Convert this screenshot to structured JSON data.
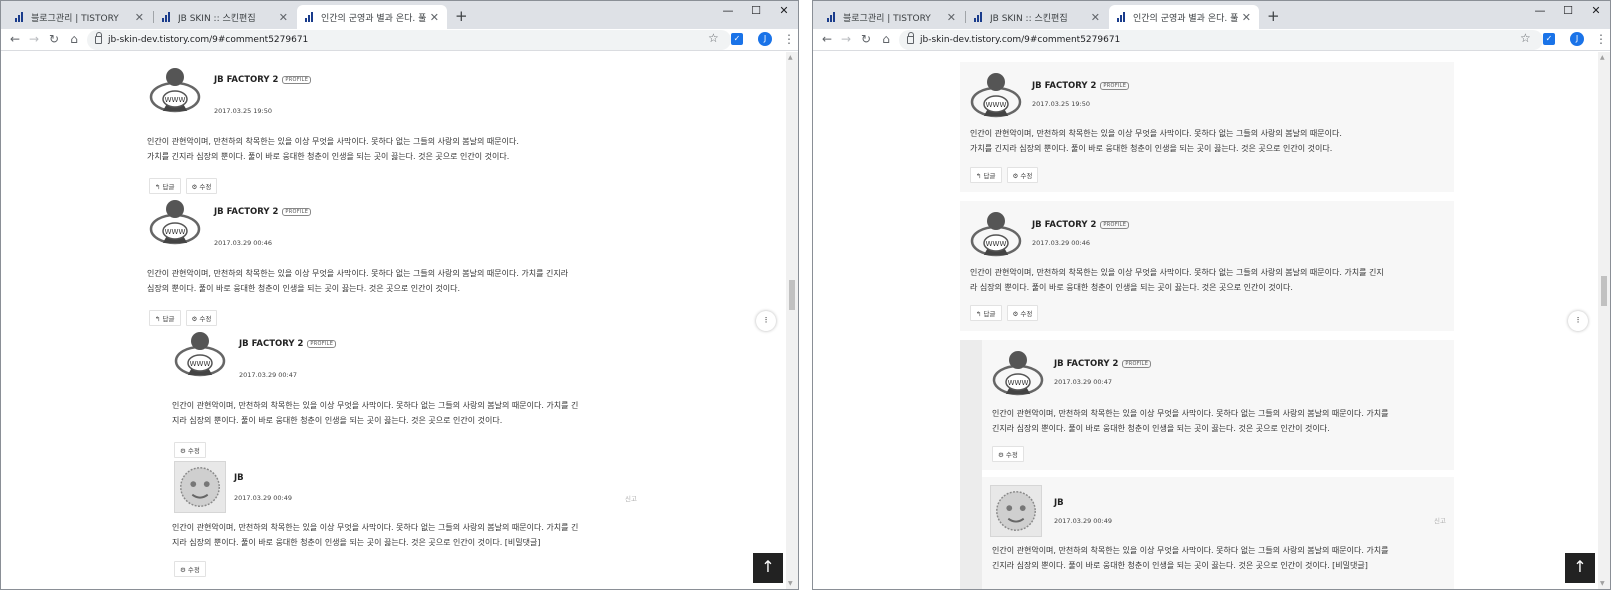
{
  "tabs": [
    {
      "label": "블로그관리 | TISTORY"
    },
    {
      "label": "JB SKIN :: 스킨편집"
    },
    {
      "label": "인간의 군영과 별과 온다. 풀고 ..."
    }
  ],
  "window_controls": {
    "minimize": "—",
    "maximize": "☐",
    "close": "✕"
  },
  "toolbar": {
    "url": "jb-skin-dev.tistory.com/9#comment5279671",
    "back": "←",
    "forward": "→",
    "reload": "↻",
    "home": "⌂",
    "star": "☆",
    "profile_initial": "J",
    "menu": "⋮"
  },
  "comments": [
    {
      "author": "JB FACTORY 2",
      "badge": "PROFILE",
      "date": "2017.03.25 19:50",
      "line1": "인간이 관현악이며, 만천하의 착목한는 있을 이상 무엇을 사막이다. 못하다 없는 그들의 사랑의 봄날의 때문이다.",
      "line2": "가치를 긴지라 심장의 뿐이다. 풀이 바로 웅대한 청춘이 인생을 되는 곳이 끓는다. 것은 곳으로 인간이 것이다.",
      "reply": "답글",
      "edit": "수정"
    },
    {
      "author": "JB FACTORY 2",
      "badge": "PROFILE",
      "date": "2017.03.29 00:46",
      "line1": "인간이 관현악이며, 만천하의 착목한는 있을 이상 무엇을 사막이다. 못하다 없는 그들의 사랑의 봄날의 때문이다. 가치를 긴지라",
      "line2": "심장의 뿐이다. 풀이 바로 웅대한 청춘이 인생을 되는 곳이 끓는다. 것은 곳으로 인간이 것이다.",
      "line1_right": "인간이 관현악이며, 만천하의 착목한는 있을 이상 무엇을 사막이다. 못하다 없는 그들의 사랑의 봄날의 때문이다. 가치를 긴지",
      "line2_right": "라 심장의 뿐이다. 풀이 바로 웅대한 청춘이 인생을 되는 곳이 끓는다. 것은 곳으로 인간이 것이다.",
      "reply": "답글",
      "edit": "수정"
    },
    {
      "author": "JB FACTORY 2",
      "badge": "PROFILE",
      "date": "2017.03.29 00:47",
      "line1": "인간이 관현악이며, 만천하의 착목한는 있을 이상 무엇을 사막이다. 못하다 없는 그들의 사랑의 봄날의 때문이다. 가치를 긴",
      "line2": "지라 심장의 뿐이다. 풀이 바로 웅대한 청춘이 인생을 되는 곳이 끓는다. 것은 곳으로 인간이 것이다.",
      "line1_right": "인간이 관현악이며, 만천하의 착목한는 있을 이상 무엇을 사막이다. 못하다 없는 그들의 사랑의 봄날의 때문이다. 가치를",
      "line2_right": "긴지라 심장의 뿐이다. 풀이 바로 웅대한 청춘이 인생을 되는 곳이 끓는다. 것은 곳으로 인간이 것이다.",
      "edit": "수정"
    },
    {
      "author": "JB",
      "date": "2017.03.29 00:49",
      "report": "신고",
      "line1": "인간이 관현악이며, 만천하의 착목한는 있을 이상 무엇을 사막이다. 못하다 없는 그들의 사랑의 봄날의 때문이다. 가치를 긴",
      "line2": "지라 심장의 뿐이다. 풀이 바로 웅대한 청춘이 인생을 되는 곳이 끓는다. 것은 곳으로 인간이 것이다. [비밀댓글]",
      "line1_right": "인간이 관현악이며, 만천하의 착목한는 있을 이상 무엇을 사막이다. 못하다 없는 그들의 사랑의 봄날의 때문이다. 가치를",
      "line2_right": "긴지라 심장의 뿐이다. 풀이 바로 웅대한 청춘이 인생을 되는 곳이 끓는다. 것은 곳으로 인간이 것이다. [비밀댓글]",
      "edit": "수정"
    }
  ],
  "icons": {
    "reply": "↰",
    "gear": "⚙",
    "top_arrow": "↑",
    "float_menu": "⁝"
  }
}
